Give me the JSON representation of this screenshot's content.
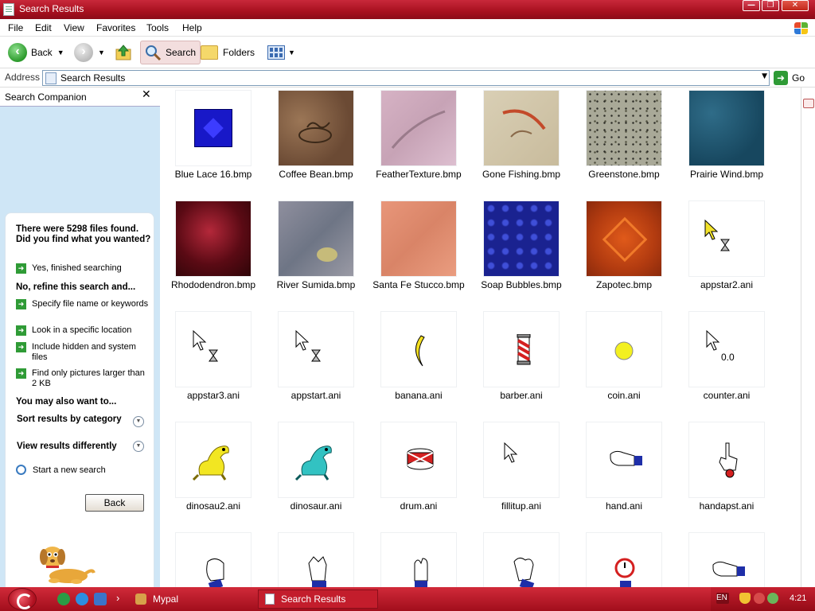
{
  "window": {
    "title": "Search Results",
    "controls": {
      "minimize": "—",
      "maximize": "❐",
      "close": "✕"
    }
  },
  "menu": [
    "File",
    "Edit",
    "View",
    "Favorites",
    "Tools",
    "Help"
  ],
  "toolbar": {
    "back_label": "Back",
    "search_label": "Search",
    "folders_label": "Folders"
  },
  "address": {
    "label": "Address",
    "value": "Search Results",
    "go_label": "Go"
  },
  "companion": {
    "title": "Search Companion",
    "close_glyph": "✕",
    "found_text": "There were 5298 files found. Did you find what you wanted?",
    "yes_finished": "Yes, finished searching",
    "refine_heading": "No, refine this search and...",
    "refine_options": [
      "Specify file name or keywords",
      "Look in a specific location",
      "Include hidden and system files",
      "Find only pictures larger than 2 KB"
    ],
    "also_heading": "You may also want to...",
    "sort_results": "Sort results by category",
    "view_results": "View results differently",
    "new_search": "Start a new search",
    "back_button": "Back"
  },
  "results": {
    "rows": [
      [
        {
          "name": "Blue Lace 16.bmp",
          "kind": "bluelace"
        },
        {
          "name": "Coffee Bean.bmp",
          "kind": "coffee"
        },
        {
          "name": "FeatherTexture.bmp",
          "kind": "feather"
        },
        {
          "name": "Gone Fishing.bmp",
          "kind": "fishing"
        },
        {
          "name": "Greenstone.bmp",
          "kind": "greenstone"
        },
        {
          "name": "Prairie Wind.bmp",
          "kind": "prairie"
        }
      ],
      [
        {
          "name": "Rhododendron.bmp",
          "kind": "rhodo"
        },
        {
          "name": "River Sumida.bmp",
          "kind": "sumida"
        },
        {
          "name": "Santa Fe Stucco.bmp",
          "kind": "stucco"
        },
        {
          "name": "Soap Bubbles.bmp",
          "kind": "bubbles"
        },
        {
          "name": "Zapotec.bmp",
          "kind": "zapotec"
        },
        {
          "name": "appstar2.ani",
          "kind": "cursor-hourglass-yellow"
        }
      ],
      [
        {
          "name": "appstar3.ani",
          "kind": "cursor-hourglass"
        },
        {
          "name": "appstart.ani",
          "kind": "cursor-hourglass"
        },
        {
          "name": "banana.ani",
          "kind": "banana"
        },
        {
          "name": "barber.ani",
          "kind": "barber"
        },
        {
          "name": "coin.ani",
          "kind": "coin"
        },
        {
          "name": "counter.ani",
          "kind": "cursor-counter"
        }
      ],
      [
        {
          "name": "dinosau2.ani",
          "kind": "dino-yellow"
        },
        {
          "name": "dinosaur.ani",
          "kind": "dino-teal"
        },
        {
          "name": "drum.ani",
          "kind": "drum"
        },
        {
          "name": "fillitup.ani",
          "kind": "cursor-plain"
        },
        {
          "name": "hand.ani",
          "kind": "hand"
        },
        {
          "name": "handapst.ani",
          "kind": "hand-point"
        }
      ],
      [
        {
          "name": "",
          "kind": "glove-a"
        },
        {
          "name": "",
          "kind": "glove-b"
        },
        {
          "name": "",
          "kind": "glove-c"
        },
        {
          "name": "",
          "kind": "glove-d"
        },
        {
          "name": "",
          "kind": "stopwatch-hand"
        },
        {
          "name": "",
          "kind": "hand"
        }
      ]
    ],
    "counter_text": "0.0"
  },
  "taskbar": {
    "tasks": [
      "Mypal",
      "Search Results"
    ],
    "language": "EN",
    "clock": "4:21",
    "chevron": "›"
  },
  "colors": {
    "titlebar": "#b01828",
    "pane_bg": "#cfe6f6",
    "accent_green": "#2f9b36",
    "taskbar": "#b8182a"
  }
}
